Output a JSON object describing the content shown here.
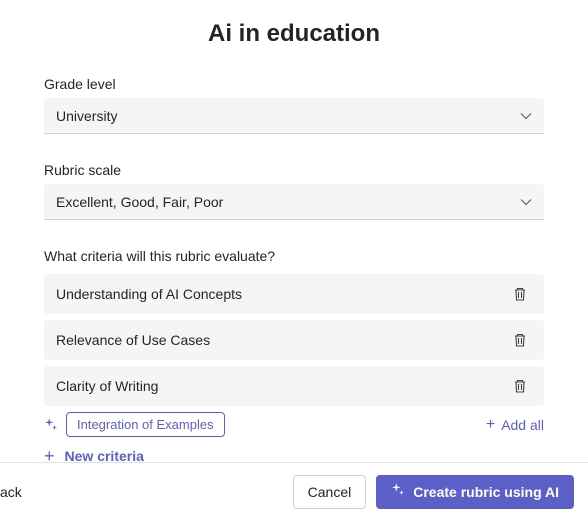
{
  "title": "Ai in education",
  "gradeLevel": {
    "label": "Grade level",
    "value": "University"
  },
  "rubricScale": {
    "label": "Rubric scale",
    "value": "Excellent, Good, Fair, Poor"
  },
  "criteriaQuestion": "What criteria will this rubric evaluate?",
  "criteria": [
    {
      "text": "Understanding of AI Concepts"
    },
    {
      "text": "Relevance of Use Cases"
    },
    {
      "text": "Clarity of Writing"
    }
  ],
  "suggestion": "Integration of Examples",
  "addAll": "Add all",
  "newCriteria": "New criteria",
  "footer": {
    "backFragment": "ack",
    "cancel": "Cancel",
    "create": "Create rubric using AI"
  }
}
